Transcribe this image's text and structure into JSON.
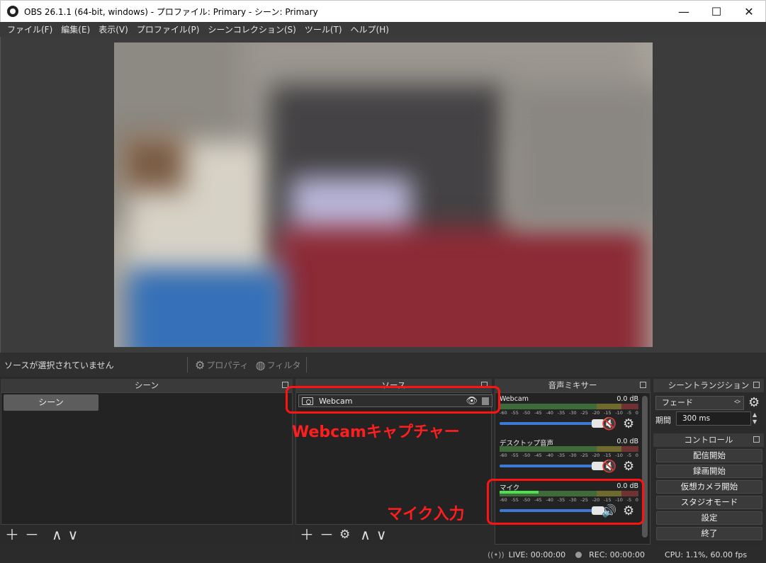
{
  "window": {
    "title": "OBS 26.1.1 (64-bit, windows) - プロファイル: Primary - シーン: Primary",
    "minimize": "—",
    "maximize": "☐",
    "close": "✕"
  },
  "menu": [
    "ファイル(F)",
    "編集(E)",
    "表示(V)",
    "プロファイル(P)",
    "シーンコレクション(S)",
    "ツール(T)",
    "ヘルプ(H)"
  ],
  "source_toolbar": {
    "no_source": "ソースが選択されていません",
    "properties": "プロパティ",
    "filters": "フィルタ"
  },
  "scenes": {
    "header": "シーン",
    "items": [
      "シーン"
    ]
  },
  "sources": {
    "header": "ソース",
    "items": [
      {
        "name": "Webcam",
        "icon": "camera-icon"
      }
    ]
  },
  "mixer": {
    "header": "音声ミキサー",
    "ticks": [
      "-60",
      "-55",
      "-50",
      "-45",
      "-40",
      "-35",
      "-30",
      "-25",
      "-20",
      "-15",
      "-10",
      "-5",
      "0"
    ],
    "channels": [
      {
        "name": "Webcam",
        "db": "0.0 dB",
        "muted": true,
        "level": 0,
        "volume": 1.0
      },
      {
        "name": "デスクトップ音声",
        "db": "0.0 dB",
        "muted": true,
        "level": 0,
        "volume": 1.0
      },
      {
        "name": "マイク",
        "db": "0.0 dB",
        "muted": false,
        "level": 0.28,
        "volume": 1.0
      }
    ]
  },
  "transitions": {
    "header": "シーントランジション",
    "selected": "フェード",
    "duration_label": "期間",
    "duration_value": "300 ms"
  },
  "controls": {
    "header": "コントロール",
    "buttons": [
      "配信開始",
      "録画開始",
      "仮想カメラ開始",
      "スタジオモード",
      "設定",
      "終了"
    ]
  },
  "status": {
    "live": "LIVE: 00:00:00",
    "rec": "REC: 00:00:00",
    "cpu": "CPU: 1.1%, 60.00 fps"
  },
  "annotations": {
    "webcam": "Webcamキャプチャー",
    "mic": "マイク入力"
  },
  "colors": {
    "annotation": "#ff1212",
    "slider": "#3d7ad6",
    "mute_red": "#e02424"
  }
}
